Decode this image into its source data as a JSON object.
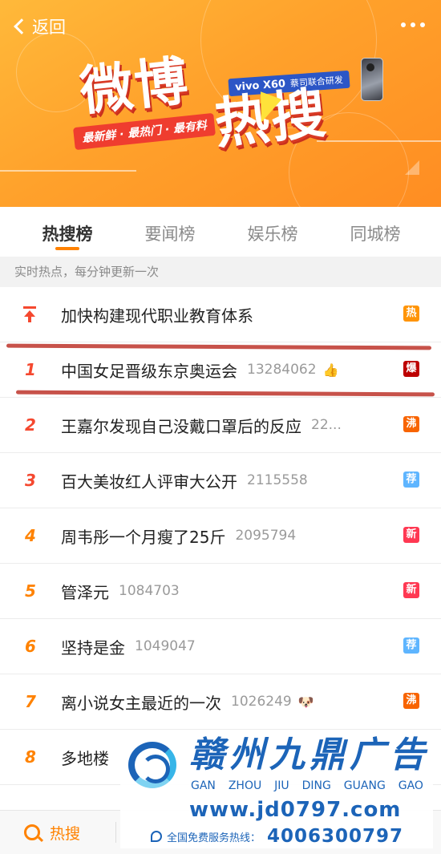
{
  "nav": {
    "back_label": "返回",
    "more_icon": "more-dots-icon"
  },
  "banner": {
    "title_part1": "微博",
    "title_part2": "热搜",
    "slogan": "最新鲜 · 最热门 · 最有料",
    "sponsor_model": "vivo X60",
    "sponsor_text": "蔡司联合研发"
  },
  "tabs": [
    {
      "label": "热搜榜",
      "active": true
    },
    {
      "label": "要闻榜",
      "active": false
    },
    {
      "label": "娱乐榜",
      "active": false
    },
    {
      "label": "同城榜",
      "active": false
    }
  ],
  "subhead": "实时热点，每分钟更新一次",
  "list": [
    {
      "rank": "",
      "pinned": true,
      "title": "加快构建现代职业教育体系",
      "count": "",
      "emoji": "",
      "badge": "热",
      "badge_color": "#ff9406"
    },
    {
      "rank": "1",
      "pinned": false,
      "title": "中国女足晋级东京奥运会",
      "count": "13284062",
      "emoji": "👍",
      "badge": "爆",
      "badge_color": "#bd0000"
    },
    {
      "rank": "2",
      "pinned": false,
      "title": "王嘉尔发现自己没戴口罩后的反应",
      "count": "22...",
      "emoji": "",
      "badge": "沸",
      "badge_color": "#f86400"
    },
    {
      "rank": "3",
      "pinned": false,
      "title": "百大美妆红人评审大公开",
      "count": "2115558",
      "emoji": "",
      "badge": "荐",
      "badge_color": "#5eb5ff"
    },
    {
      "rank": "4",
      "pinned": false,
      "title": "周韦彤一个月瘦了25斤",
      "count": "2095794",
      "emoji": "",
      "badge": "新",
      "badge_color": "#ff3852"
    },
    {
      "rank": "5",
      "pinned": false,
      "title": "管泽元",
      "count": "1084703",
      "emoji": "",
      "badge": "新",
      "badge_color": "#ff3852"
    },
    {
      "rank": "6",
      "pinned": false,
      "title": "坚持是金",
      "count": "1049047",
      "emoji": "",
      "badge": "荐",
      "badge_color": "#5eb5ff"
    },
    {
      "rank": "7",
      "pinned": false,
      "title": "离小说女主最近的一次",
      "count": "1026249",
      "emoji": "🐶",
      "badge": "沸",
      "badge_color": "#f86400"
    },
    {
      "rank": "8",
      "pinned": false,
      "title": "多地楼",
      "count": "",
      "emoji": "",
      "badge": "",
      "badge_color": ""
    }
  ],
  "bottombar": {
    "search_label": "热搜"
  },
  "watermark": {
    "name": "赣州九鼎广告",
    "pinyin": [
      "GAN",
      "ZHOU",
      "JIU",
      "DING",
      "GUANG",
      "GAO"
    ],
    "url": "www.jd0797.com",
    "hotline_label": "全国免费服务热线：",
    "hotline_number": "4006300797"
  },
  "colors": {
    "accent": "#ff8200",
    "rank_top": "#f5482f",
    "watermark_blue": "#1c64b8"
  }
}
